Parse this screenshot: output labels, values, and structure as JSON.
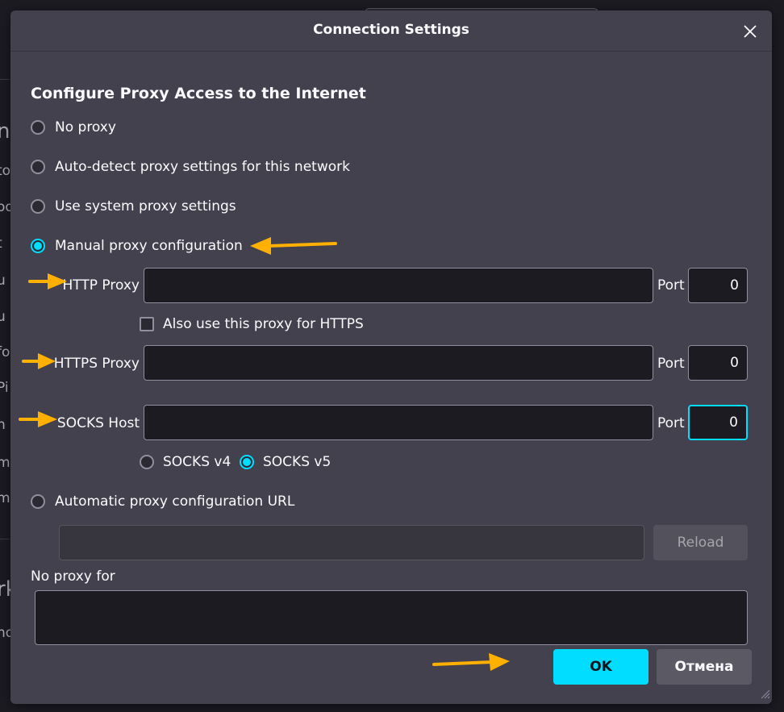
{
  "dialog": {
    "title": "Connection Settings",
    "heading": "Configure Proxy Access to the Internet"
  },
  "options": {
    "no_proxy": "No proxy",
    "auto_detect": "Auto-detect proxy settings for this network",
    "system": "Use system proxy settings",
    "manual": "Manual proxy configuration",
    "auto_url": "Automatic proxy configuration URL",
    "selected": "manual"
  },
  "fields": {
    "http_proxy_label": "HTTP Proxy",
    "http_proxy_value": "",
    "https_checkbox_label": "Also use this proxy for HTTPS",
    "https_checked": false,
    "https_proxy_label": "HTTPS Proxy",
    "https_proxy_value": "",
    "socks_host_label": "SOCKS Host",
    "socks_host_value": "",
    "port_label": "Port",
    "http_port": "0",
    "https_port": "0",
    "socks_port": "0",
    "socks_v4": "SOCKS v4",
    "socks_v5": "SOCKS v5",
    "socks_version_selected": "v5",
    "auto_url_value": "",
    "reload_label": "Reload",
    "no_proxy_for_label": "No proxy for",
    "no_proxy_for_value": ""
  },
  "buttons": {
    "ok": "OK",
    "cancel": "Отмена"
  },
  "background_page": {
    "fragments": [
      "ng",
      "to",
      "oo",
      "t",
      "u",
      "u",
      "fo",
      "Pi",
      "n",
      "m",
      "m",
      "rk",
      "no"
    ]
  },
  "colors": {
    "accent": "#00ddff",
    "annotation_arrow": "#ffb000",
    "dialog_bg": "#42414d",
    "input_bg": "#1c1b22"
  },
  "icons": {
    "close": "close-icon",
    "arrow": "arrow-annotation-icon",
    "resize": "resize-grip-icon"
  }
}
